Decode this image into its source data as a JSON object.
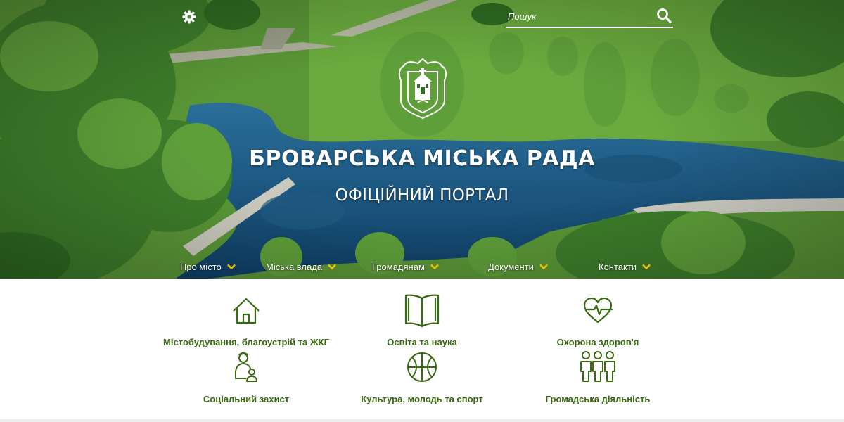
{
  "header": {
    "search_placeholder": "Пошук",
    "settings_icon": "gear-icon",
    "search_icon": "search-icon"
  },
  "hero": {
    "title": "БРОВАРСЬКА МІСЬКА РАДА",
    "subtitle": "ОФІЦІЙНИЙ ПОРТАЛ",
    "emblem": "city-emblem"
  },
  "nav": {
    "items": [
      {
        "label": "Про місто"
      },
      {
        "label": "Міська влада"
      },
      {
        "label": "Громадянам"
      },
      {
        "label": "Документи"
      },
      {
        "label": "Контакти"
      }
    ]
  },
  "categories": {
    "items": [
      {
        "label": "Містобудування, благоустрій та ЖКГ",
        "icon": "house-icon"
      },
      {
        "label": "Освіта та наука",
        "icon": "book-icon"
      },
      {
        "label": "Охорона здоров'я",
        "icon": "heart-pulse-icon"
      },
      {
        "label": "Соціальний захист",
        "icon": "social-care-icon"
      },
      {
        "label": "Культура, молодь та спорт",
        "icon": "basketball-icon"
      },
      {
        "label": "Громадська діяльність",
        "icon": "people-icon"
      }
    ]
  },
  "colors": {
    "accent_green": "#3a6b12",
    "chevron_yellow": "#f2c200",
    "text_white": "#ffffff"
  }
}
